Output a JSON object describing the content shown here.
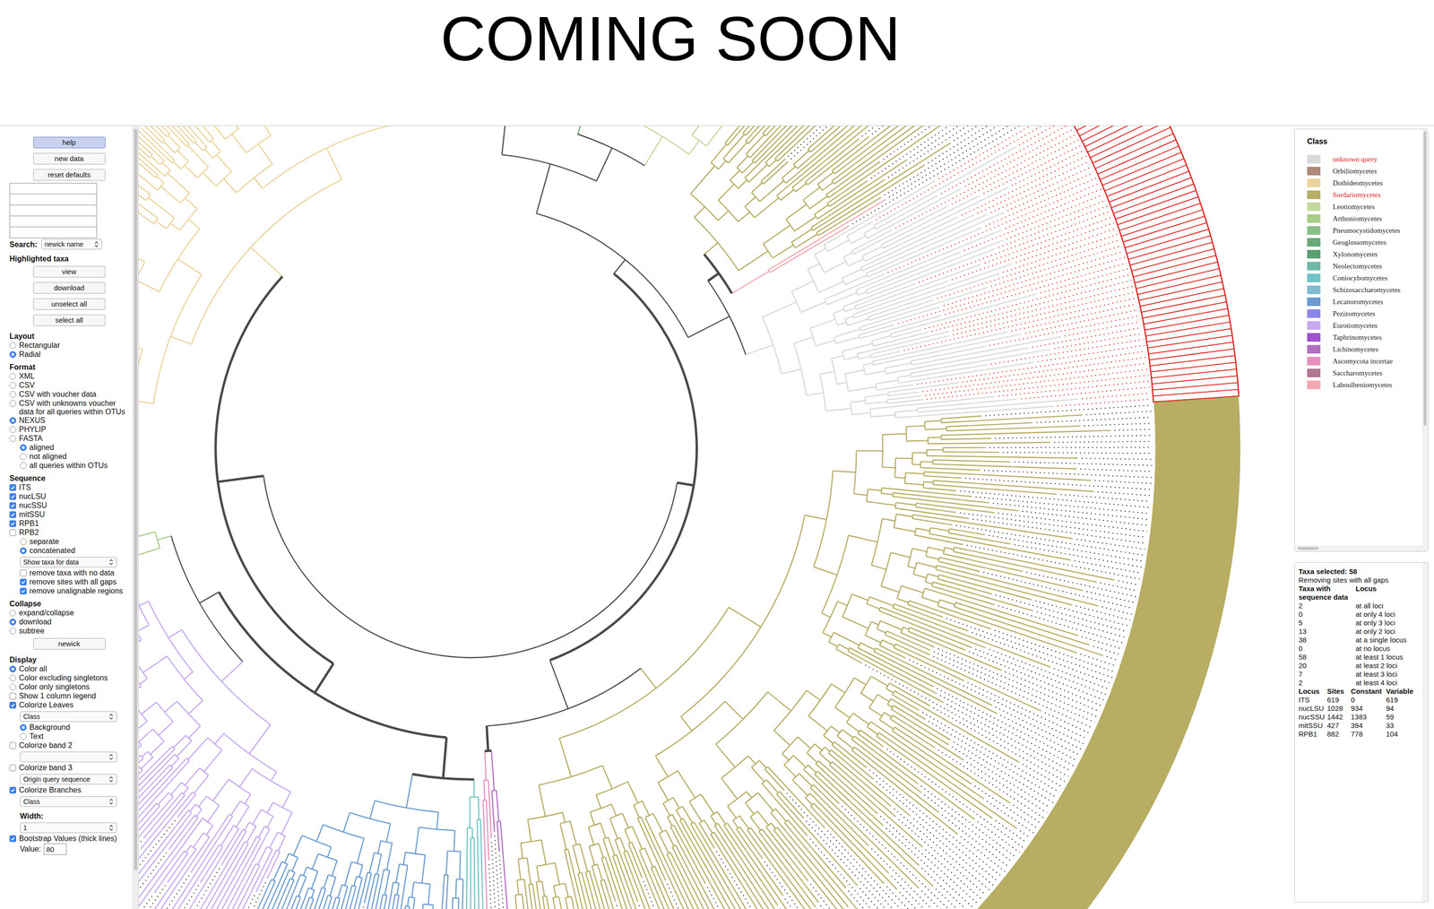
{
  "header": {
    "title": "COMING SOON"
  },
  "sidebar": {
    "items": [
      {
        "kind": "button",
        "label": "help",
        "selected": true,
        "sub": false
      },
      {
        "kind": "button",
        "label": "new data",
        "selected": false,
        "sub": false
      },
      {
        "kind": "button",
        "label": "reset defaults",
        "selected": false,
        "sub": false
      },
      {
        "kind": "field",
        "label": "",
        "value": "",
        "sub": false
      },
      {
        "kind": "field",
        "label": "",
        "value": "",
        "sub": false
      },
      {
        "kind": "field",
        "label": "",
        "value": "",
        "sub": false
      },
      {
        "kind": "field",
        "label": "",
        "value": "",
        "sub": false
      },
      {
        "kind": "field",
        "label": "",
        "value": "",
        "sub": false
      },
      {
        "kind": "select",
        "label": "Search:",
        "value": "newick name",
        "sub": false
      },
      {
        "kind": "heading",
        "label": "Highlighted taxa",
        "sub": false
      },
      {
        "kind": "button",
        "label": "view",
        "selected": false,
        "sub": false
      },
      {
        "kind": "button",
        "label": "download",
        "selected": false,
        "sub": false
      },
      {
        "kind": "button",
        "label": "unselect all",
        "selected": false,
        "sub": false
      },
      {
        "kind": "button",
        "label": "select all",
        "selected": false,
        "sub": false
      },
      {
        "kind": "heading",
        "label": "Layout",
        "sub": false
      },
      {
        "kind": "radio",
        "label": "Rectangular",
        "selected": false,
        "sub": false
      },
      {
        "kind": "radio",
        "label": "Radial",
        "selected": true,
        "sub": false
      },
      {
        "kind": "heading",
        "label": "Format",
        "sub": false
      },
      {
        "kind": "radio",
        "label": "XML",
        "selected": false,
        "sub": false
      },
      {
        "kind": "radio",
        "label": "CSV",
        "selected": false,
        "sub": false
      },
      {
        "kind": "radio",
        "label": "CSV with voucher data",
        "selected": false,
        "sub": false
      },
      {
        "kind": "radio",
        "label": "CSV with unknowns voucher data for all queries within OTUs",
        "selected": false,
        "sub": false
      },
      {
        "kind": "radio",
        "label": "NEXUS",
        "selected": true,
        "sub": false
      },
      {
        "kind": "radio",
        "label": "PHYLIP",
        "selected": false,
        "sub": false
      },
      {
        "kind": "radio",
        "label": "FASTA",
        "selected": false,
        "sub": false
      },
      {
        "kind": "radio",
        "label": "aligned",
        "selected": true,
        "sub": true
      },
      {
        "kind": "radio",
        "label": "not aligned",
        "selected": false,
        "sub": true
      },
      {
        "kind": "radio",
        "label": "all queries within OTUs",
        "selected": false,
        "sub": true
      },
      {
        "kind": "heading",
        "label": "Sequence",
        "sub": false
      },
      {
        "kind": "checkbox",
        "label": "ITS",
        "checked": true,
        "sub": false
      },
      {
        "kind": "checkbox",
        "label": "nucLSU",
        "checked": true,
        "sub": false
      },
      {
        "kind": "checkbox",
        "label": "nucSSU",
        "checked": true,
        "sub": false
      },
      {
        "kind": "checkbox",
        "label": "mitSSU",
        "checked": true,
        "sub": false
      },
      {
        "kind": "checkbox",
        "label": "RPB1",
        "checked": true,
        "sub": false
      },
      {
        "kind": "checkbox",
        "label": "RPB2",
        "checked": false,
        "sub": false
      },
      {
        "kind": "radio",
        "label": "separate",
        "selected": false,
        "sub": true
      },
      {
        "kind": "radio",
        "label": "concatenated",
        "selected": true,
        "sub": true
      },
      {
        "kind": "select",
        "label": "",
        "value": "Show taxa for data",
        "sub": true
      },
      {
        "kind": "checkbox",
        "label": "remove taxa with no data",
        "checked": false,
        "sub": true
      },
      {
        "kind": "checkbox",
        "label": "remove sites with all gaps",
        "checked": true,
        "sub": true
      },
      {
        "kind": "checkbox",
        "label": "remove unalignable regions",
        "checked": true,
        "sub": true
      },
      {
        "kind": "heading",
        "label": "Collapse",
        "sub": false
      },
      {
        "kind": "radio",
        "label": "expand/collapse",
        "selected": false,
        "sub": false
      },
      {
        "kind": "radio",
        "label": "download",
        "selected": true,
        "sub": false
      },
      {
        "kind": "radio",
        "label": "subtree",
        "selected": false,
        "sub": false
      },
      {
        "kind": "button",
        "label": "newick",
        "selected": false,
        "sub": false
      },
      {
        "kind": "heading",
        "label": "Display",
        "sub": false
      },
      {
        "kind": "radio",
        "label": "Color all",
        "selected": true,
        "sub": false
      },
      {
        "kind": "radio",
        "label": "Color excluding singletons",
        "selected": false,
        "sub": false
      },
      {
        "kind": "radio",
        "label": "Color only singletons",
        "selected": false,
        "sub": false
      },
      {
        "kind": "checkbox",
        "label": "Show 1 column legend",
        "checked": false,
        "sub": false
      },
      {
        "kind": "checkbox",
        "label": "Colorize Leaves",
        "checked": true,
        "sub": false
      },
      {
        "kind": "select",
        "label": "",
        "value": "Class",
        "sub": true
      },
      {
        "kind": "radio",
        "label": "Background",
        "selected": true,
        "sub": true
      },
      {
        "kind": "radio",
        "label": "Text",
        "selected": false,
        "sub": true
      },
      {
        "kind": "checkbox",
        "label": "Colorize band 2",
        "checked": false,
        "sub": false
      },
      {
        "kind": "select",
        "label": "",
        "value": "",
        "sub": true
      },
      {
        "kind": "checkbox",
        "label": "Colorize band 3",
        "checked": false,
        "sub": false
      },
      {
        "kind": "select",
        "label": "",
        "value": "Origin query sequence",
        "sub": true
      },
      {
        "kind": "checkbox",
        "label": "Colorize Branches",
        "checked": true,
        "sub": false
      },
      {
        "kind": "select",
        "label": "",
        "value": "Class",
        "sub": true
      },
      {
        "kind": "heading",
        "label": "Width:",
        "sub": true
      },
      {
        "kind": "select",
        "label": "",
        "value": "1",
        "sub": true
      },
      {
        "kind": "checkbox",
        "label": "Bootstrap Values (thick lines)",
        "checked": true,
        "sub": false
      },
      {
        "kind": "field",
        "label": "Value:",
        "value": "80",
        "sub": true
      }
    ]
  },
  "legend": {
    "title": "Class",
    "items": [
      {
        "label": "unknown query",
        "color": "#d9d9d9",
        "highlighted": true
      },
      {
        "label": "Orbiliomycetes",
        "color": "#b08a7a",
        "highlighted": false
      },
      {
        "label": "Dothideomycetes",
        "color": "#ecd49c",
        "highlighted": false
      },
      {
        "label": "Sordariomycetes",
        "color": "#b7ad63",
        "highlighted": true
      },
      {
        "label": "Leotiomycetes",
        "color": "#c4d8a0",
        "highlighted": false
      },
      {
        "label": "Arthoniomycetes",
        "color": "#a8cc88",
        "highlighted": false
      },
      {
        "label": "Pneumocystidomycetes",
        "color": "#8cc08a",
        "highlighted": false
      },
      {
        "label": "Geoglossomycetes",
        "color": "#6aaa78",
        "highlighted": false
      },
      {
        "label": "Xylonomycetes",
        "color": "#5a9e70",
        "highlighted": false
      },
      {
        "label": "Neolectomycetes",
        "color": "#70b8a8",
        "highlighted": false
      },
      {
        "label": "Coniocybomycetes",
        "color": "#70c4c8",
        "highlighted": false
      },
      {
        "label": "Schizosaccharomycetes",
        "color": "#80bcd4",
        "highlighted": false
      },
      {
        "label": "Lecanoromycetes",
        "color": "#6a9bd0",
        "highlighted": false
      },
      {
        "label": "Pezizomycetes",
        "color": "#8b87ea",
        "highlighted": false
      },
      {
        "label": "Eurotiomycetes",
        "color": "#c7a9ee",
        "highlighted": false
      },
      {
        "label": "Taphrinomycetes",
        "color": "#a050d0",
        "highlighted": false
      },
      {
        "label": "Lichinomycetes",
        "color": "#b070c0",
        "highlighted": false
      },
      {
        "label": "Ascomycota incertae",
        "color": "#e890c0",
        "highlighted": false
      },
      {
        "label": "Saccharomycetes",
        "color": "#b07890",
        "highlighted": false
      },
      {
        "label": "Laboulbeniomycetes",
        "color": "#f4a8b0",
        "highlighted": false
      }
    ]
  },
  "stats": {
    "title": "Taxa selected: 58",
    "note": "Removing sites with all gaps",
    "coverage_columns": [
      "Taxa with sequence data",
      "Locus"
    ],
    "coverage": [
      [
        "2",
        "at all loci"
      ],
      [
        "0",
        "at only 4 loci"
      ],
      [
        "5",
        "at only 3 loci"
      ],
      [
        "13",
        "at only 2 loci"
      ],
      [
        "38",
        "at a single locus"
      ],
      [
        "0",
        "at no locus"
      ],
      [
        "58",
        "at least 1 locus"
      ],
      [
        "20",
        "at least 2 loci"
      ],
      [
        "7",
        "at least 3 loci"
      ],
      [
        "2",
        "at least 4 loci"
      ]
    ],
    "locus_columns": [
      "Locus",
      "Sites",
      "Constant",
      "Variable"
    ],
    "loci": [
      [
        "ITS",
        "619",
        "0",
        "619"
      ],
      [
        "nucLSU",
        "1028",
        "934",
        "94"
      ],
      [
        "nucSSU",
        "1442",
        "1383",
        "59"
      ],
      [
        "mitSSU",
        "427",
        "394",
        "33"
      ],
      [
        "RPB1",
        "882",
        "778",
        "104"
      ]
    ]
  },
  "tree": {
    "clades": [
      {
        "class": "Orbiliomycetes",
        "leaves": 8,
        "selected": false
      },
      {
        "class": "Pezizomycetes",
        "leaves": 32,
        "selected": false
      },
      {
        "class": "Geoglossomycetes",
        "leaves": 2,
        "selected": false
      },
      {
        "class": "Leotiomycetes",
        "leaves": 40,
        "selected": false
      },
      {
        "class": "Sordariomycetes",
        "leaves": 38,
        "selected": false
      },
      {
        "class": "Laboulbeniomycetes",
        "leaves": 2,
        "selected": false
      },
      {
        "class": "unknown query",
        "leaves": 52,
        "selected": true
      },
      {
        "class": "Sordariomycetes",
        "leaves": 176,
        "selected": false
      },
      {
        "class": "Lichinomycetes",
        "leaves": 3,
        "selected": false
      },
      {
        "class": "Ascomycota incertae",
        "leaves": 3,
        "selected": false
      },
      {
        "class": "Coniocybomycetes",
        "leaves": 5,
        "selected": false
      },
      {
        "class": "Lecanoromycetes",
        "leaves": 48,
        "selected": false
      },
      {
        "class": "Eurotiomycetes",
        "leaves": 90,
        "selected": false
      },
      {
        "class": "Arthoniomycetes",
        "leaves": 10,
        "selected": false
      },
      {
        "class": "Dothideomycetes",
        "leaves": 202,
        "selected": false
      }
    ]
  }
}
